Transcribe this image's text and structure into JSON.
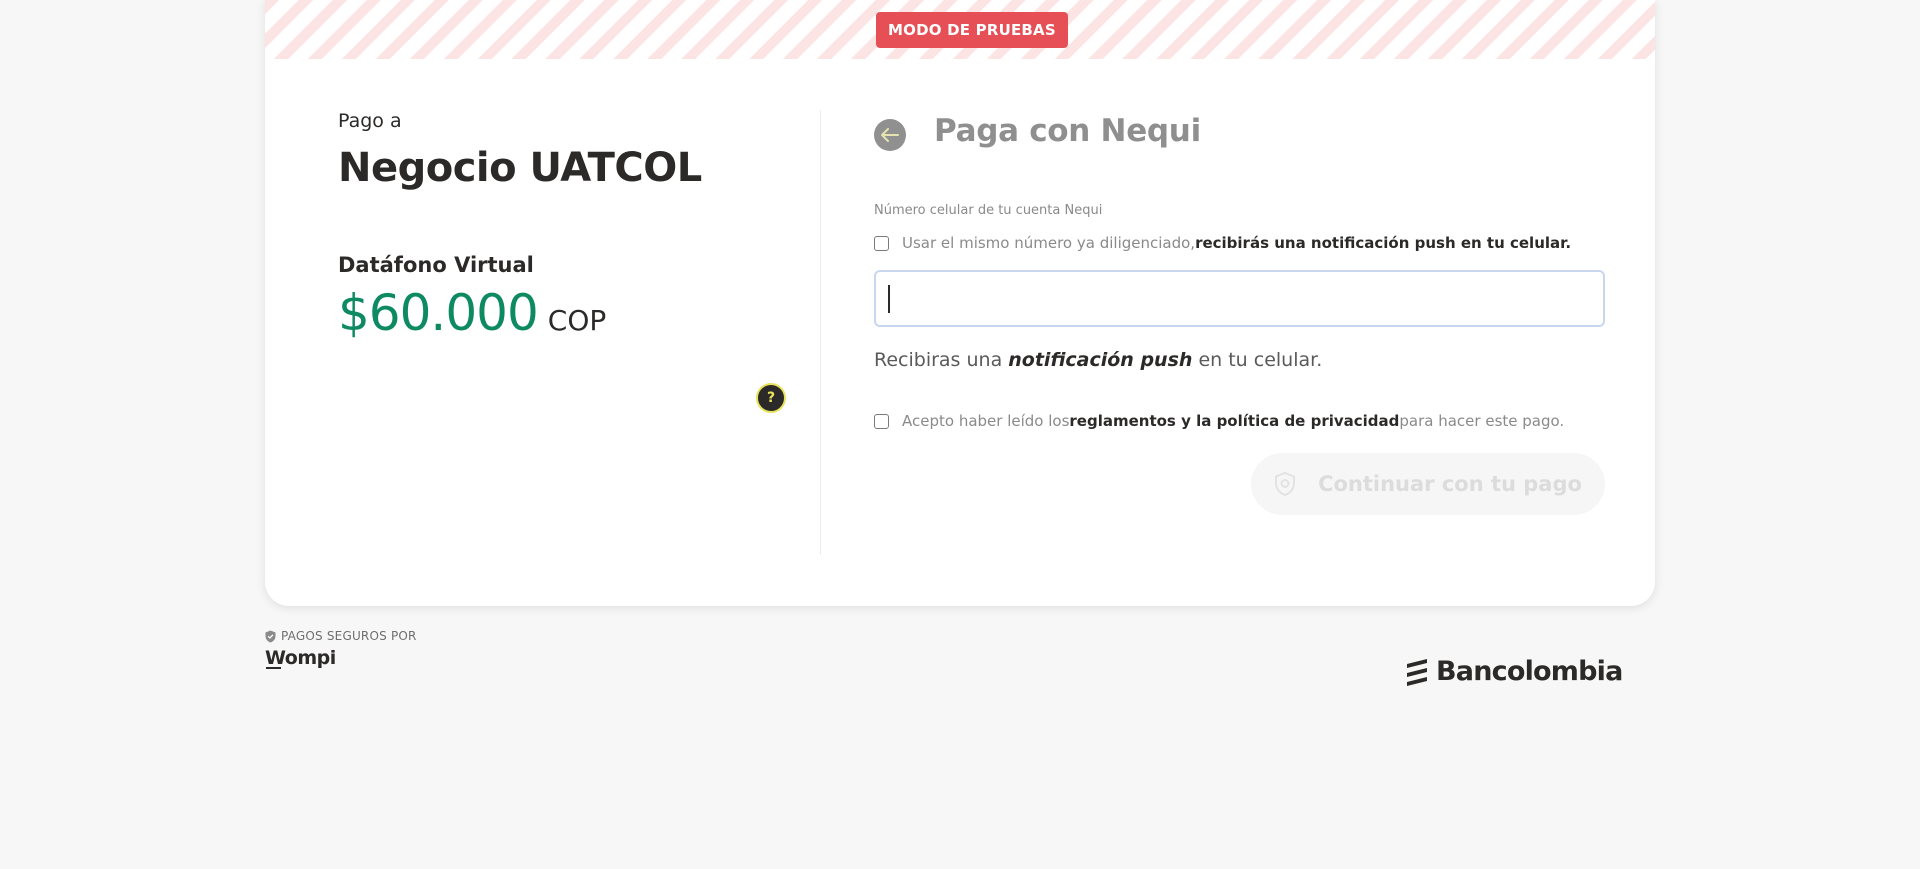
{
  "test_mode": {
    "label": "MODO DE PRUEBAS"
  },
  "merchant": {
    "pay_to_label": "Pago a",
    "name": "Negocio UATCOL",
    "product": "Datáfono Virtual",
    "amount": "$60.000",
    "currency": "COP"
  },
  "help_button": {
    "symbol": "?"
  },
  "nequi": {
    "title": "Paga con Nequi",
    "phone_label": "Número celular de tu cuenta Nequi",
    "same_number_text": "Usar el mismo número ya diligenciado, ",
    "same_number_bold": "recibirás una notificación push en tu celular.",
    "phone_value": "",
    "push_prefix": "Recibiras una ",
    "push_bold": "notificación push",
    "push_suffix": " en tu celular.",
    "terms_prefix": "Acepto haber leído los ",
    "terms_bold": "reglamentos y la política de privacidad",
    "terms_suffix": " para hacer este pago.",
    "continue_label": "Continuar con tu pago"
  },
  "footer": {
    "secure_label": "PAGOS SEGUROS POR",
    "wompi": "Wompi",
    "bancolombia": "Bancolombia"
  },
  "colors": {
    "accent_green": "#0e8a62",
    "test_badge": "#e54f55",
    "input_border": "#c9d6f0"
  }
}
